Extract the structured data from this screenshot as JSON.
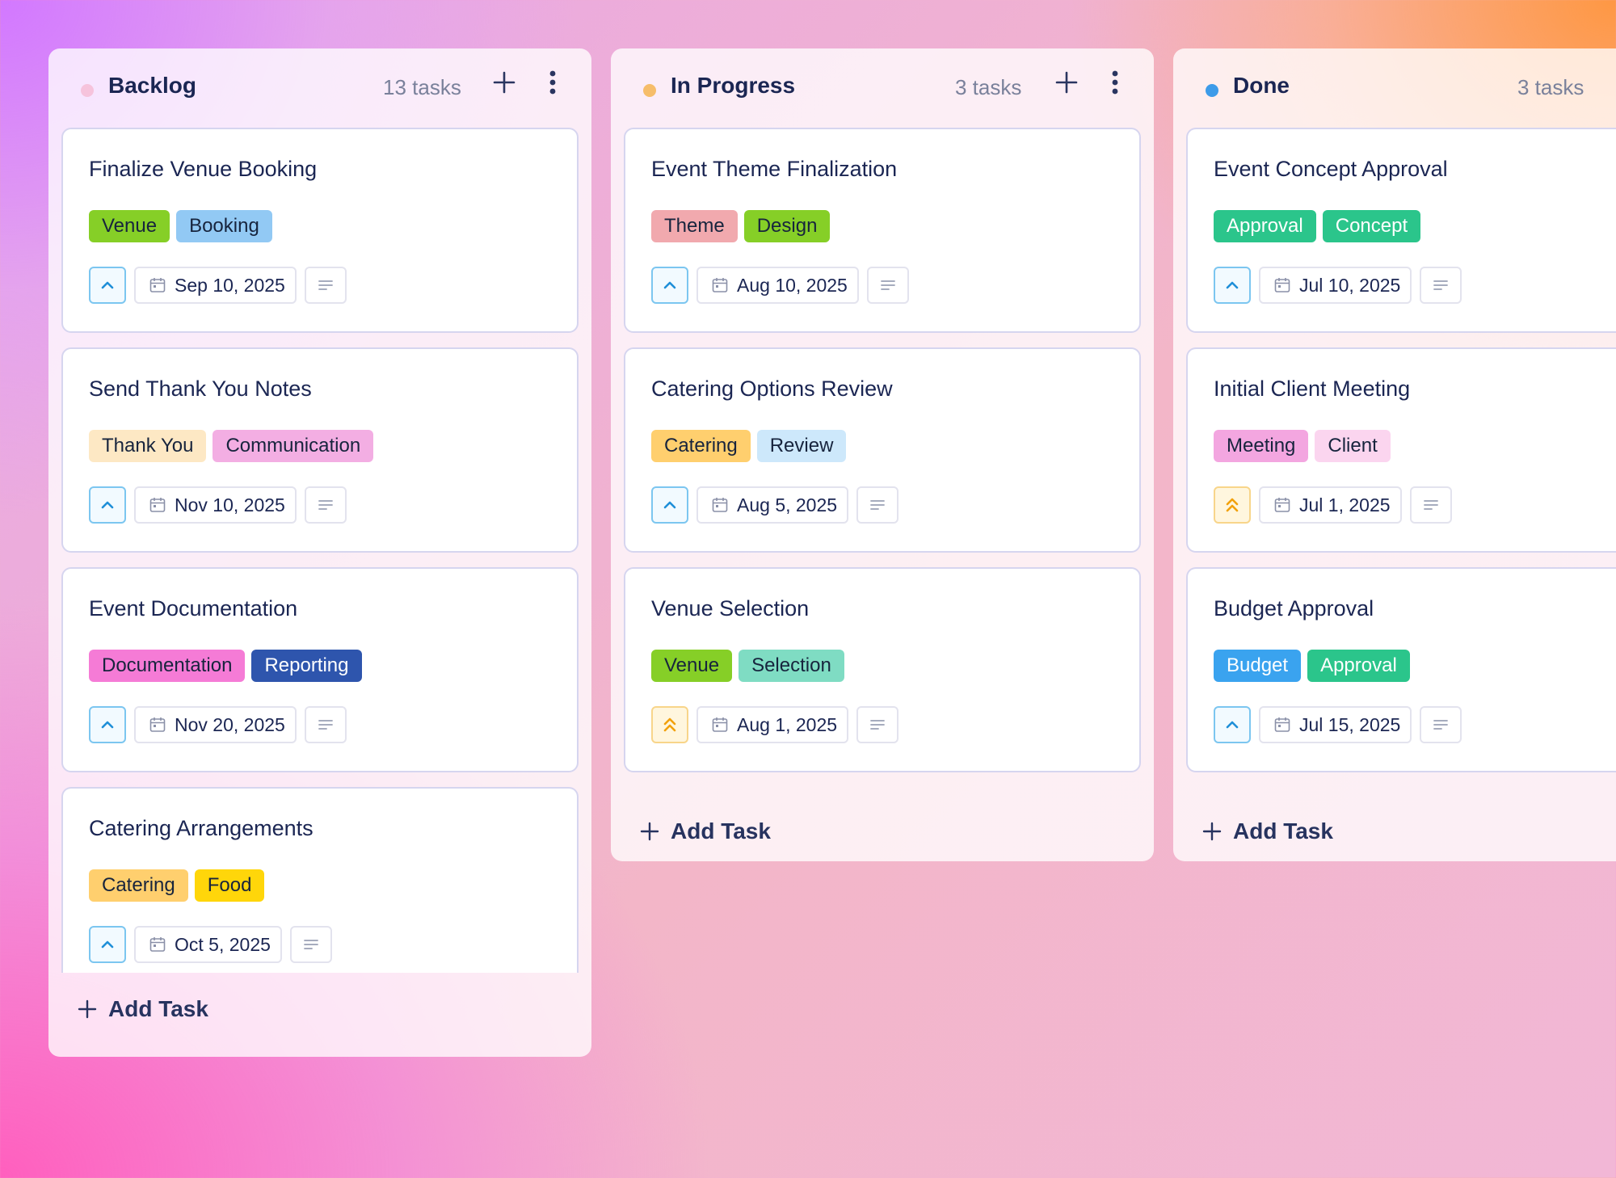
{
  "columns": [
    {
      "title": "Backlog",
      "count": "13 tasks",
      "dot_color": "#f6c3dc",
      "has_actions": true,
      "add_label": "Add Task",
      "cards": [
        {
          "title": "Finalize Venue Booking",
          "tags": [
            {
              "label": "Venue",
              "bg": "#86cf27",
              "fg": "#17243d"
            },
            {
              "label": "Booking",
              "bg": "#92c9f4",
              "fg": "#17243d"
            }
          ],
          "priority": "up",
          "date": "Sep 10, 2025"
        },
        {
          "title": "Send Thank You Notes",
          "tags": [
            {
              "label": "Thank You",
              "bg": "#fde8c4",
              "fg": "#17243d"
            },
            {
              "label": "Communication",
              "bg": "#f3aee3",
              "fg": "#17243d"
            }
          ],
          "priority": "up",
          "date": "Nov 10, 2025"
        },
        {
          "title": "Event Documentation",
          "tags": [
            {
              "label": "Documentation",
              "bg": "#f57bd6",
              "fg": "#17243d"
            },
            {
              "label": "Reporting",
              "bg": "#2e55ad",
              "fg": "#ffffff"
            }
          ],
          "priority": "up",
          "date": "Nov 20, 2025"
        },
        {
          "title": "Catering Arrangements",
          "tags": [
            {
              "label": "Catering",
              "bg": "#ffcf6e",
              "fg": "#17243d"
            },
            {
              "label": "Food",
              "bg": "#ffd60a",
              "fg": "#17243d"
            }
          ],
          "priority": "up",
          "date": "Oct 5, 2025"
        }
      ]
    },
    {
      "title": "In Progress",
      "count": "3 tasks",
      "dot_color": "#f6bd6a",
      "has_actions": true,
      "add_label": "Add Task",
      "cards": [
        {
          "title": "Event Theme Finalization",
          "tags": [
            {
              "label": "Theme",
              "bg": "#f1a9ae",
              "fg": "#17243d"
            },
            {
              "label": "Design",
              "bg": "#86cf27",
              "fg": "#17243d"
            }
          ],
          "priority": "up",
          "date": "Aug 10, 2025"
        },
        {
          "title": "Catering Options Review",
          "tags": [
            {
              "label": "Catering",
              "bg": "#ffcf6e",
              "fg": "#17243d"
            },
            {
              "label": "Review",
              "bg": "#cde8fb",
              "fg": "#17243d"
            }
          ],
          "priority": "up",
          "date": "Aug 5, 2025"
        },
        {
          "title": "Venue Selection",
          "tags": [
            {
              "label": "Venue",
              "bg": "#86cf27",
              "fg": "#17243d"
            },
            {
              "label": "Selection",
              "bg": "#7fdcc3",
              "fg": "#17243d"
            }
          ],
          "priority": "high",
          "date": "Aug 1, 2025"
        }
      ]
    },
    {
      "title": "Done",
      "count": "3 tasks",
      "dot_color": "#3d9be9",
      "has_actions": false,
      "add_label": "Add Task",
      "cards": [
        {
          "title": "Event Concept Approval",
          "tags": [
            {
              "label": "Approval",
              "bg": "#2bc58b",
              "fg": "#ffffff"
            },
            {
              "label": "Concept",
              "bg": "#2bc58b",
              "fg": "#ffffff"
            }
          ],
          "priority": "up",
          "date": "Jul 10, 2025"
        },
        {
          "title": "Initial Client Meeting",
          "tags": [
            {
              "label": "Meeting",
              "bg": "#f3a6e0",
              "fg": "#17243d"
            },
            {
              "label": "Client",
              "bg": "#fbd5ef",
              "fg": "#17243d"
            }
          ],
          "priority": "high",
          "date": "Jul 1, 2025"
        },
        {
          "title": "Budget Approval",
          "tags": [
            {
              "label": "Budget",
              "bg": "#3aa3ef",
              "fg": "#ffffff"
            },
            {
              "label": "Approval",
              "bg": "#2bc58b",
              "fg": "#ffffff"
            }
          ],
          "priority": "up",
          "date": "Jul 15, 2025"
        }
      ]
    }
  ]
}
